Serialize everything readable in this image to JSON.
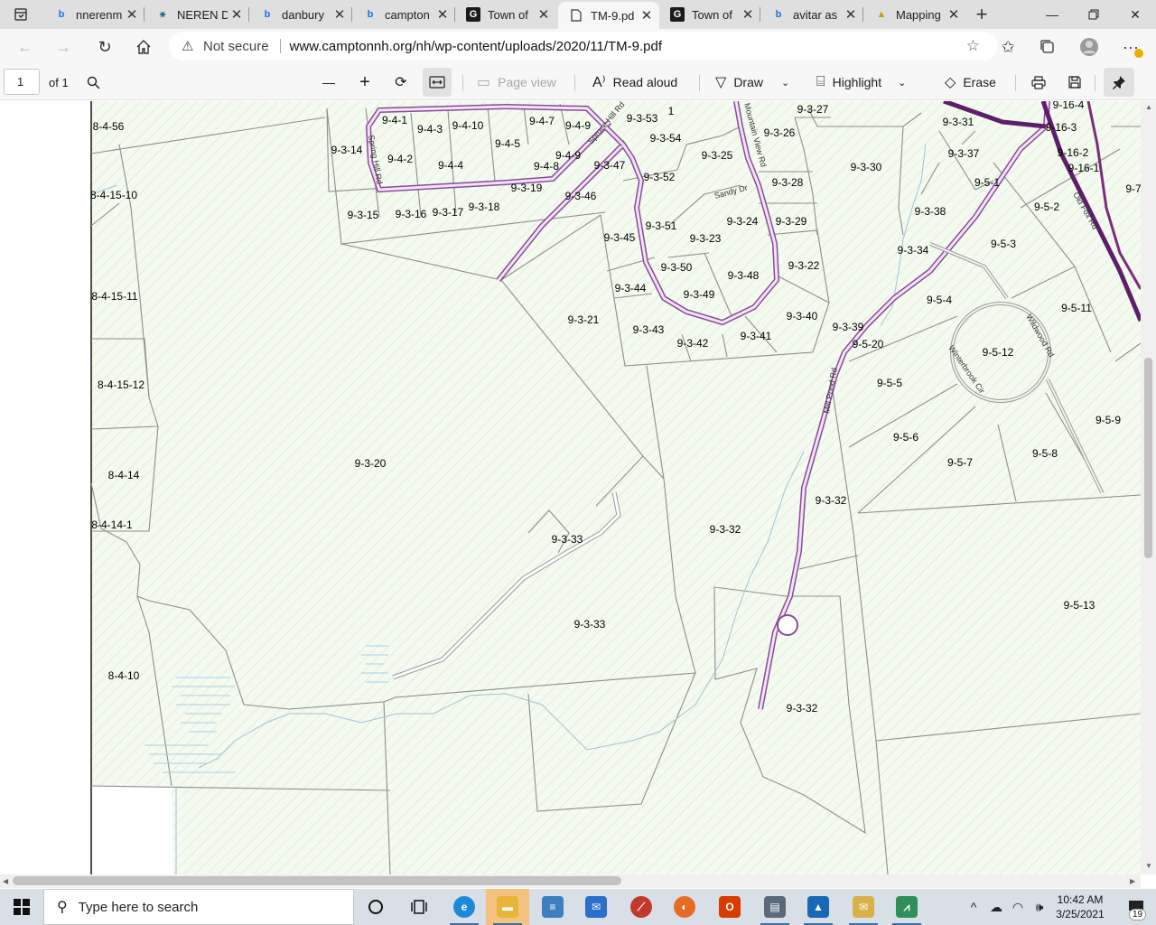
{
  "tabs": [
    {
      "icon": "bing-icon",
      "title": "nnerenm",
      "active": false
    },
    {
      "icon": "neren-icon",
      "title": "NEREN D",
      "active": false
    },
    {
      "icon": "bing-icon",
      "title": "danbury",
      "active": false
    },
    {
      "icon": "bing-icon",
      "title": "campton",
      "active": false
    },
    {
      "icon": "g-icon",
      "title": "Town of",
      "active": false
    },
    {
      "icon": "pdf-icon",
      "title": "TM-9.pd",
      "active": true
    },
    {
      "icon": "g-icon",
      "title": "Town of",
      "active": false
    },
    {
      "icon": "bing-icon",
      "title": "avitar as",
      "active": false
    },
    {
      "icon": "mapping-icon",
      "title": "Mapping",
      "active": false
    }
  ],
  "address": {
    "security": "Not secure",
    "url": "www.camptonnh.org/nh/wp-content/uploads/2020/11/TM-9.pdf"
  },
  "pdf_toolbar": {
    "page_current": "1",
    "page_of": "of 1",
    "page_view": "Page view",
    "read_aloud": "Read aloud",
    "draw": "Draw",
    "highlight": "Highlight",
    "erase": "Erase"
  },
  "map": {
    "parcels": [
      "8-4-56",
      "8-4-15-10",
      "8-4-15-11",
      "8-4-15-12",
      "8-4-14",
      "8-4-14-1",
      "8-4-10",
      "9-4-1",
      "9-4-3",
      "9-4-10",
      "9-4-7",
      "9-4-9",
      "9-3-53",
      "1",
      "9-3-27",
      "9-3-31",
      "9-16-4",
      "9-3-14",
      "9-4-5",
      "9-4-2",
      "9-4-4",
      "9-4-9",
      "9-4-8",
      "9-3-54",
      "9-3-26",
      "9-16-3",
      "9-3-47",
      "9-3-25",
      "9-3-30",
      "9-3-37",
      "9-16-2",
      "9-16-1",
      "9-3-52",
      "9-5-1",
      "9-7",
      "9-3-19",
      "9-3-28",
      "9-3-15",
      "9-3-16",
      "9-3-17",
      "9-3-18",
      "9-3-46",
      "9-5-2",
      "9-3-38",
      "9-3-51",
      "9-3-24",
      "9-3-29",
      "9-3-45",
      "9-3-23",
      "9-5-3",
      "9-3-34",
      "9-3-50",
      "9-3-22",
      "9-3-48",
      "9-3-44",
      "9-3-49",
      "9-5-4",
      "9-5-11",
      "9-3-21",
      "9-3-40",
      "9-3-39",
      "9-3-43",
      "9-3-42",
      "9-3-41",
      "9-5-20",
      "9-5-12",
      "9-5-5",
      "9-5-9",
      "9-3-20",
      "9-5-6",
      "9-5-7",
      "9-5-8",
      "9-3-32",
      "9-3-32",
      "9-3-33",
      "9-3-33",
      "9-5-13",
      "9-3-32"
    ],
    "roads": [
      "Spring Hill Rd",
      "Spruce Hill Rd",
      "Mountain View Rd",
      "Sandy Dr",
      "Mill Pond Rd",
      "Wildwood Rd",
      "Winterbrook Cir",
      "Wild Lover Rd",
      "Old Fox Rd"
    ]
  },
  "taskbar": {
    "search_placeholder": "Type here to search",
    "time": "10:42 AM",
    "date": "3/25/2021",
    "notifications": "19"
  }
}
